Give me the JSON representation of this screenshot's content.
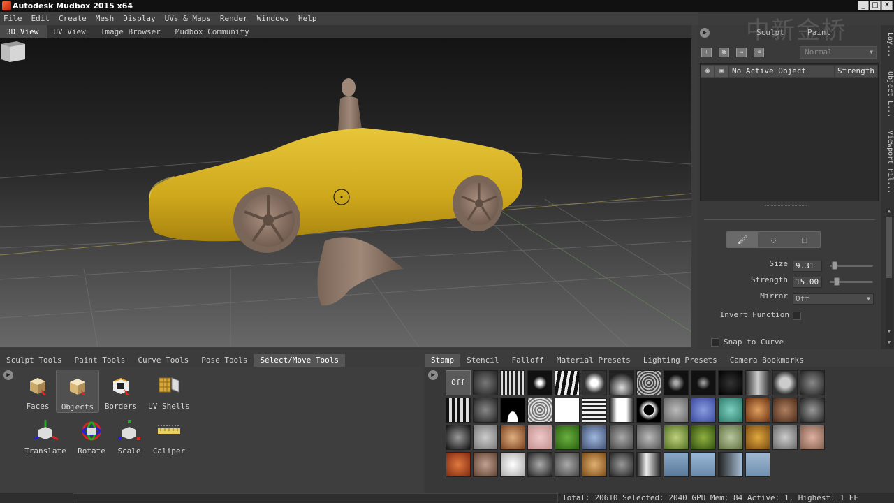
{
  "window": {
    "title": "Autodesk Mudbox 2015 x64",
    "watermark": "中新金桥"
  },
  "menu": [
    "File",
    "Edit",
    "Create",
    "Mesh",
    "Display",
    "UVs & Maps",
    "Render",
    "Windows",
    "Help"
  ],
  "view_tabs": [
    "3D View",
    "UV View",
    "Image Browser",
    "Mudbox Community"
  ],
  "right_panel": {
    "tabs": [
      "Sculpt",
      "Paint"
    ],
    "blend_mode": "Normal",
    "layer_header": {
      "name": "No Active Object",
      "strength": "Strength"
    },
    "properties": {
      "size_label": "Size",
      "size_value": "9.31",
      "size_level": 0.05,
      "strength_label": "Strength",
      "strength_value": "15.00",
      "strength_level": 0.12,
      "mirror_label": "Mirror",
      "mirror_value": "Off",
      "invert_label": "Invert Function",
      "snap_label": "Snap to Curve"
    },
    "vertical_tabs": [
      "Lay...",
      "Object L...",
      "Viewport Fil..."
    ]
  },
  "tool_tabs": [
    "Sculpt Tools",
    "Paint Tools",
    "Curve Tools",
    "Pose Tools",
    "Select/Move Tools"
  ],
  "tools": [
    "Faces",
    "Objects",
    "Borders",
    "UV Shells",
    "Translate",
    "Rotate",
    "Scale",
    "Caliper"
  ],
  "stamp_tabs": [
    "Stamp",
    "Stencil",
    "Falloff",
    "Material Presets",
    "Lighting Presets",
    "Camera Bookmarks"
  ],
  "stamps": {
    "off_label": "Off"
  },
  "status": {
    "text": "Total: 20610  Selected: 2040 GPU Mem: 84  Active: 1, Highest: 1  FF"
  }
}
